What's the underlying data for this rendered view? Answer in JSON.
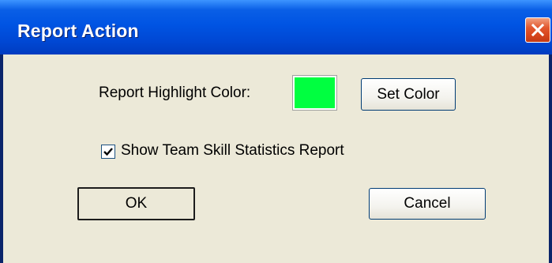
{
  "window": {
    "title": "Report Action"
  },
  "controls": {
    "highlight_label": "Report Highlight Color:",
    "highlight_color": "#00ff40",
    "set_color_label": "Set Color",
    "show_stats_label": "Show Team Skill Statistics Report",
    "show_stats_checked": true,
    "ok_label": "OK",
    "cancel_label": "Cancel"
  },
  "icons": {
    "close": "close-icon",
    "check": "checkmark-icon"
  }
}
